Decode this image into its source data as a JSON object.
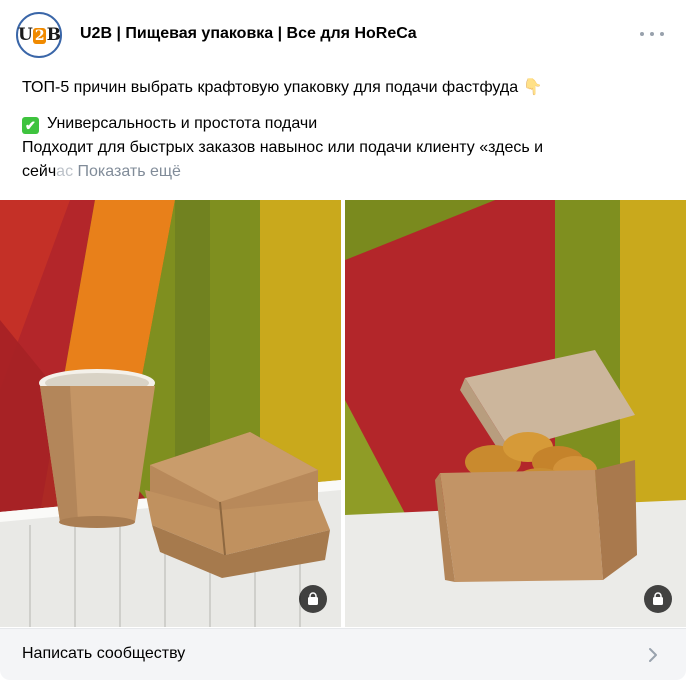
{
  "header": {
    "avatar_text_left": "U",
    "avatar_text_mid": "2",
    "avatar_text_right": "B",
    "group_name": "U2B | Пищевая упаковка | Все для HoReCa"
  },
  "post": {
    "line1": "ТОП-5 причин выбрать крафтовую упаковку для подачи фастфуда",
    "line1_emoji": "👇",
    "line2_emoji": "✔",
    "line2": "Универсальность и простота подачи",
    "line3": "Подходит для быстрых заказов навынос или подачи клиенту «здесь и",
    "line4_start": "сейч",
    "line4_faded": "ас",
    "show_more": " Показать ещё"
  },
  "photos": [
    {
      "icon": "shopping-bag-icon"
    },
    {
      "icon": "shopping-bag-icon"
    }
  ],
  "footer": {
    "label": "Написать сообществу"
  }
}
